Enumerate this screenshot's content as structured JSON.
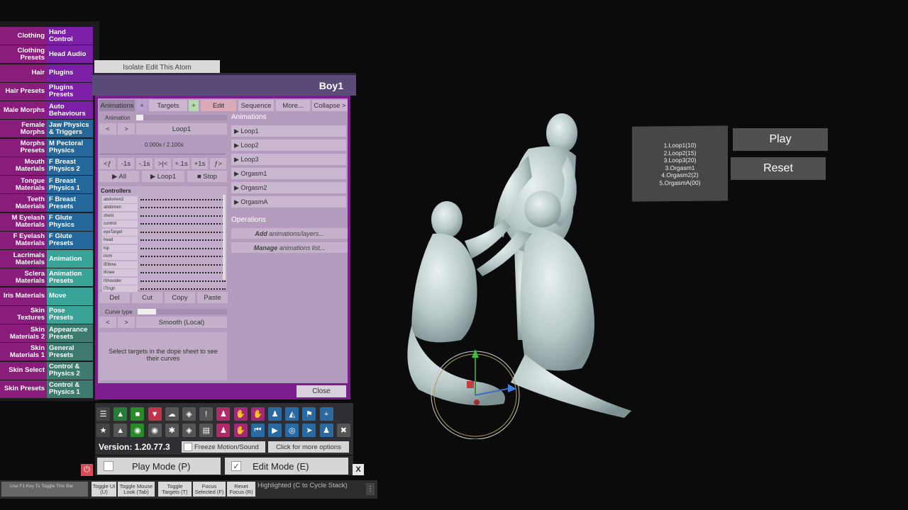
{
  "categories_left": [
    {
      "label": "Clothing",
      "color": "mag"
    },
    {
      "label": "Clothing Presets",
      "color": "mag"
    },
    {
      "label": "Hair",
      "color": "mag"
    },
    {
      "label": "Hair Presets",
      "color": "mag"
    },
    {
      "label": "Male Morphs",
      "color": "mag"
    },
    {
      "label": "Female Morphs",
      "color": "mag"
    },
    {
      "label": "Morphs Presets",
      "color": "mag"
    },
    {
      "label": "Mouth Materials",
      "color": "mag"
    },
    {
      "label": "Tongue Materials",
      "color": "mag"
    },
    {
      "label": "Teeth Materials",
      "color": "mag"
    },
    {
      "label": "M Eyelash Materials",
      "color": "mag"
    },
    {
      "label": "F Eyelash Materials",
      "color": "mag"
    },
    {
      "label": "Lacrimals Materials",
      "color": "mag"
    },
    {
      "label": "Sclera Materials",
      "color": "mag"
    },
    {
      "label": "Iris Materials",
      "color": "mag"
    },
    {
      "label": "Skin Textures",
      "color": "mag"
    },
    {
      "label": "Skin Materials 2",
      "color": "mag"
    },
    {
      "label": "Skin Materials 1",
      "color": "mag"
    },
    {
      "label": "Skin Select",
      "color": "mag"
    },
    {
      "label": "Skin Presets",
      "color": "mag"
    }
  ],
  "categories_right": [
    {
      "label": "Hand Control",
      "color": "pur"
    },
    {
      "label": "Head Audio",
      "color": "pur"
    },
    {
      "label": "Plugins",
      "color": "pur"
    },
    {
      "label": "Plugins Presets",
      "color": "pur"
    },
    {
      "label": "Auto Behaviours",
      "color": "pur"
    },
    {
      "label": "Jaw Physics & Triggers",
      "color": "blu"
    },
    {
      "label": "M Pectoral Physics",
      "color": "blu"
    },
    {
      "label": "F Breast Physics 2",
      "color": "blu"
    },
    {
      "label": "F Breast Physics 1",
      "color": "blu"
    },
    {
      "label": "F Breast Presets",
      "color": "blu"
    },
    {
      "label": "F Glute Physics",
      "color": "blu"
    },
    {
      "label": "F Glute Presets",
      "color": "blu"
    },
    {
      "label": "Animation",
      "color": "tea"
    },
    {
      "label": "Animation Presets",
      "color": "tea"
    },
    {
      "label": "Move",
      "color": "tea"
    },
    {
      "label": "Pose Presets",
      "color": "tea"
    },
    {
      "label": "Appearance Presets",
      "color": "grn"
    },
    {
      "label": "General Presets",
      "color": "grn"
    },
    {
      "label": "Control & Physics 2",
      "color": "grn"
    },
    {
      "label": "Control & Physics 1",
      "color": "grn"
    }
  ],
  "isolate_label": "Isolate Edit This Atom",
  "panel": {
    "title": "Boy1",
    "tabs": {
      "animations": "Animations",
      "plus1": "+",
      "targets": "Targets",
      "plus2": "+",
      "edit": "Edit",
      "sequence": "Sequence",
      "more": "More...",
      "collapse": "Collapse >"
    },
    "animation_label": "Animation",
    "prev": "<",
    "next": ">",
    "current_animation": "Loop1",
    "time": "0.000s / 2.100s",
    "step_buttons": [
      "<ƒ",
      "-1s",
      "-.1s",
      ">|<",
      "+.1s",
      "+1s",
      "ƒ>"
    ],
    "play_all": "▶ All",
    "play_loop": "▶ Loop1",
    "stop": "■ Stop",
    "controllers_label": "Controllers",
    "controllers": [
      "abdomen2",
      "abdomen",
      "chest",
      "control",
      "eyeTarget",
      "head",
      "hip",
      "lArm",
      "lElbow",
      "lKnee",
      "lShoulder",
      "lThigh"
    ],
    "edit_buttons": [
      "Del",
      "Cut",
      "Copy",
      "Paste"
    ],
    "curve_type_label": "Curve type",
    "curve_type_value": "Smooth (Local)",
    "hint": "Select targets in the dope sheet to see their curves",
    "animations_header": "Animations",
    "animations": [
      "▶ Loop1",
      "▶ Loop2",
      "▶ Loop3",
      "▶ Orgasm1",
      "▶ Orgasm2",
      "▶ OrgasmA"
    ],
    "operations_header": "Operations",
    "op_add_bold": "Add",
    "op_add_rest": " animations/layers...",
    "op_manage_bold": "Manage",
    "op_manage_rest": " animations list...",
    "close": "Close"
  },
  "toolbar": {
    "icons_row1": [
      "menu-icon",
      "open-scene-icon",
      "folder-icon",
      "save-icon",
      "cloud-upload-icon",
      "package-icon",
      "info-icon",
      "person-add-icon",
      "hand-icon",
      "hand-alt-icon",
      "person-icon",
      "unity-icon",
      "flag-icon",
      "plus-icon"
    ],
    "icons_row2": [
      "star-icon",
      "edit-scene-icon",
      "camera-green-icon",
      "camera-icon",
      "nodes-icon",
      "package-alt-icon",
      "document-icon",
      "person-remove-icon",
      "hand-remove-icon",
      "skip-back-icon",
      "play-icon",
      "target-icon",
      "cursor-icon",
      "people-icon",
      "tools-icon"
    ],
    "version": "Version: 1.20.77.3",
    "freeze": "Freeze Motion/Sound",
    "more_options": "Click for more options"
  },
  "modes": {
    "play_mode": "Play Mode (P)",
    "edit_mode": "Edit Mode (E)",
    "edit_check": "✓",
    "close_x": "X"
  },
  "bottom_bar": {
    "hint": "Use F1 Key To Toggle This Bar",
    "buttons": [
      "Toggle UI (U)",
      "Toggle Mouse Look (Tab)",
      "Toggle Targets (T)",
      "Focus Selected (F)",
      "Reset Focus (R)"
    ],
    "highlighted": "Highlighted (C to Cycle Stack)",
    "menu": "⋮"
  },
  "playlist": {
    "items": [
      "1.Loop1(10)",
      "2.Loop2(15)",
      "3.Loop3(20)",
      "3.Orgasm1",
      "4.Orgasm2(2)",
      "5.OrgasmA(00)"
    ],
    "play": "Play",
    "reset": "Reset"
  },
  "colors": {
    "magenta": "#8a1c7b",
    "purple": "#7a1fa6",
    "blue": "#24679a",
    "teal": "#3aa398",
    "green": "#3e7a6e",
    "panel_frame": "#7d1c8f",
    "panel_body": "#b49cbe"
  }
}
